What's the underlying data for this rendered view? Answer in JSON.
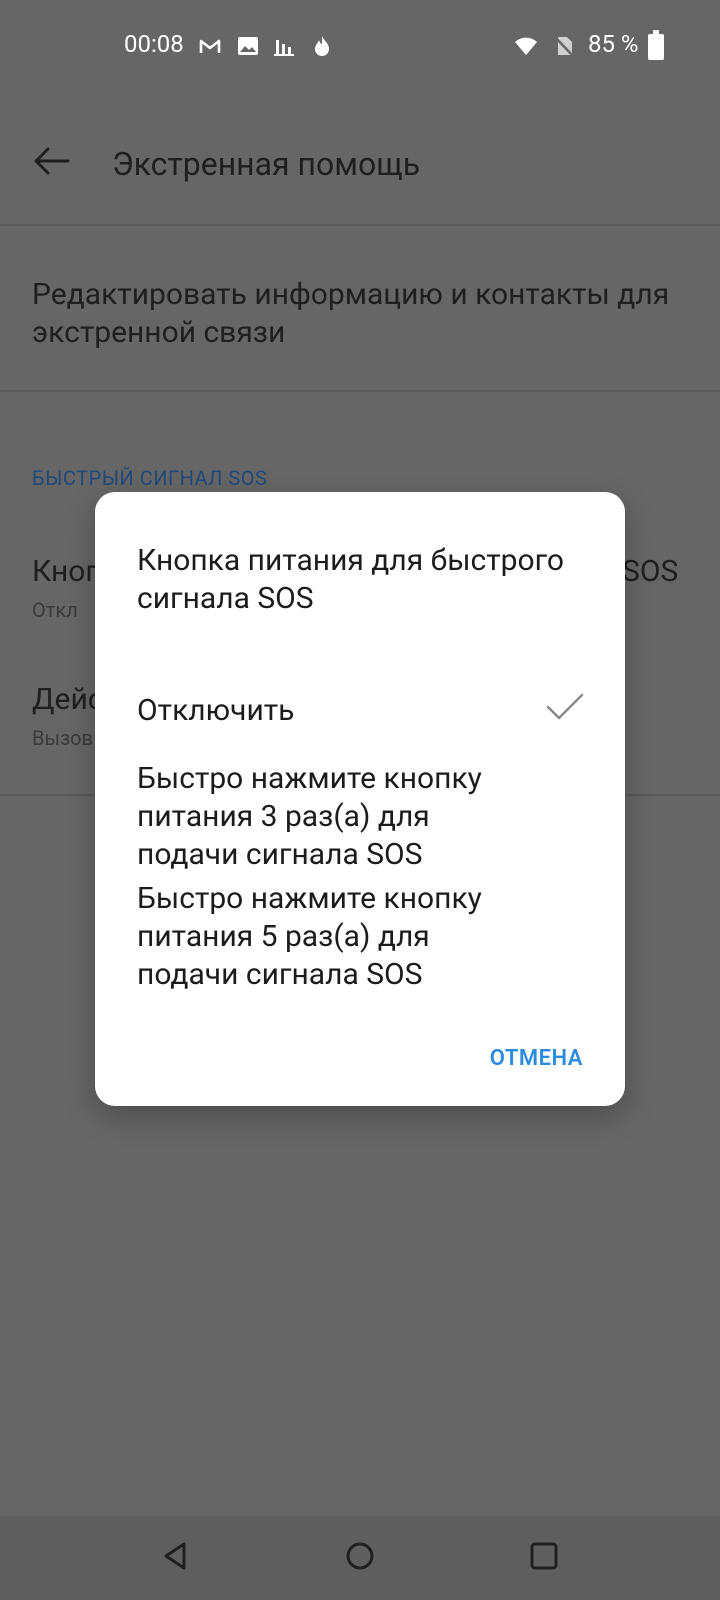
{
  "status": {
    "time": "00:08",
    "battery": "85 %",
    "icons": [
      "mail-m-icon",
      "image-icon",
      "bars-icon",
      "flame-icon",
      "wifi-icon",
      "no-sim-icon",
      "battery-icon"
    ]
  },
  "appbar": {
    "title": "Экстренная помощь"
  },
  "background": {
    "edit_info": "Редактировать информацию и контакты для экстренной связи",
    "section_header": "БЫСТРЫЙ СИГНАЛ SOS",
    "row1_title_left": "Кноп",
    "row1_title_right": "SOS",
    "row1_sub": "Откл",
    "row2_title_left": "Дейс",
    "row2_sub": "Вызов"
  },
  "dialog": {
    "title": "Кнопка питания для быстрого сигнала SOS",
    "options": [
      {
        "label": "Отключить",
        "selected": true
      },
      {
        "label": "Быстро нажмите кнопку питания 3 раз(а) для подачи сигнала SOS",
        "selected": false
      },
      {
        "label": "Быстро нажмите кнопку питания 5 раз(а) для подачи сигнала SOS",
        "selected": false
      }
    ],
    "cancel_label": "ОТМЕНА"
  },
  "colors": {
    "accent": "#2b8be0",
    "section_header": "#214a7a"
  }
}
